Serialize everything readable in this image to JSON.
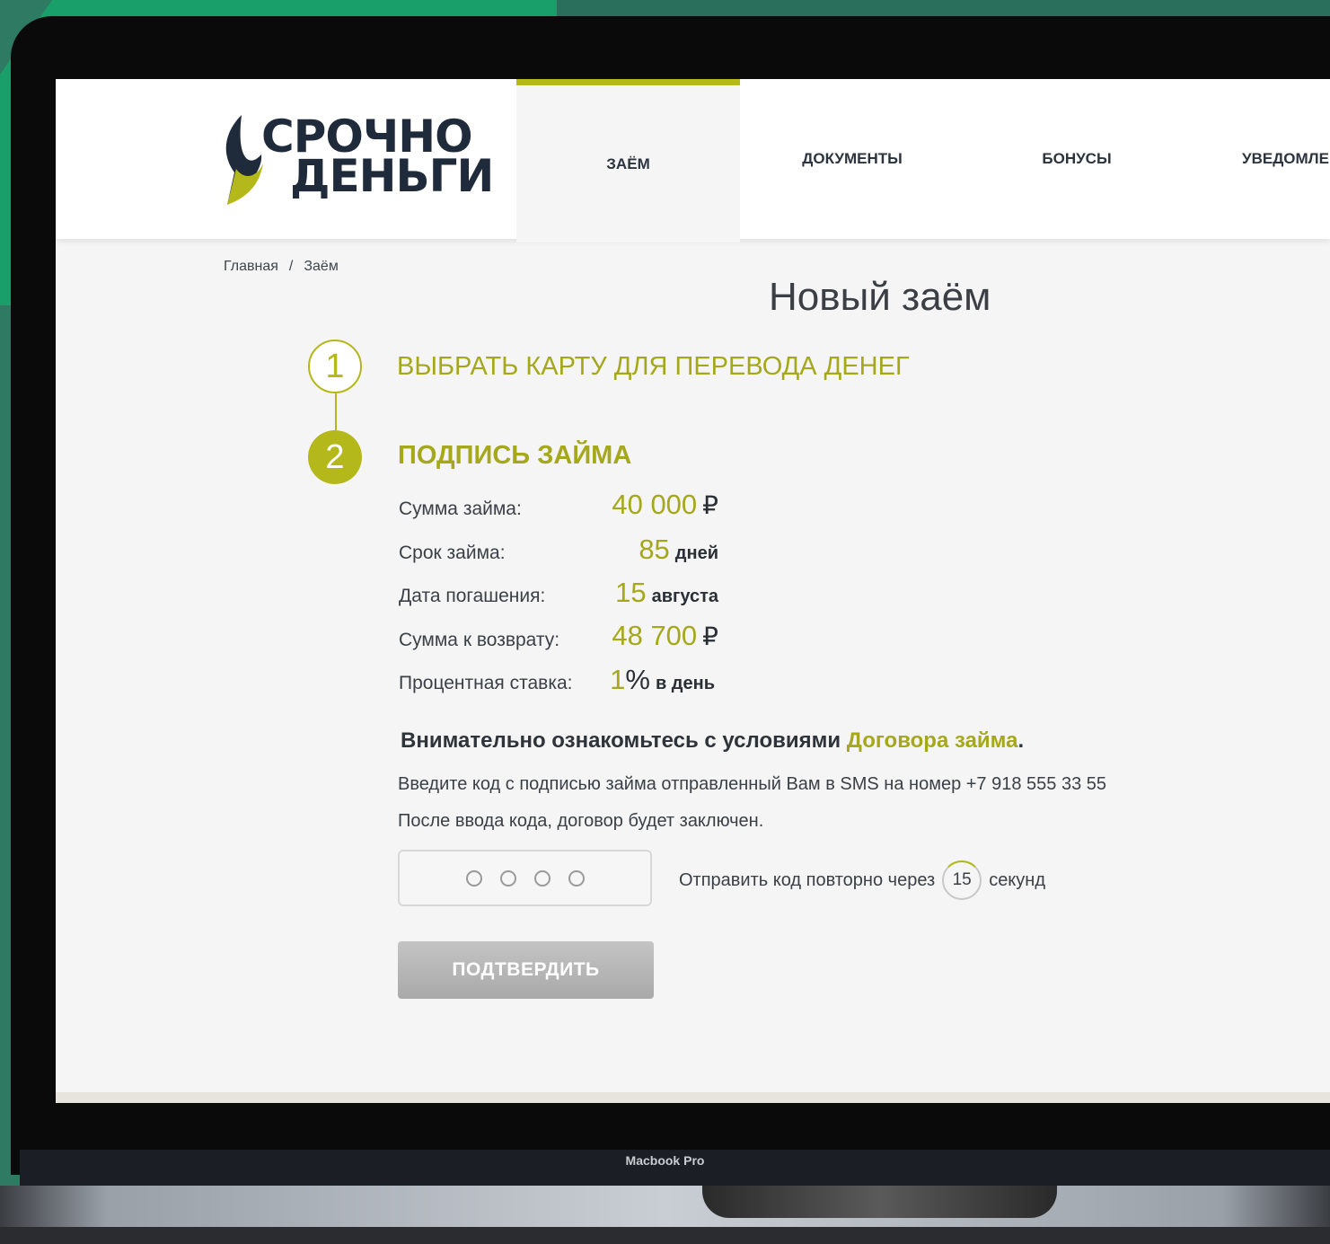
{
  "device": {
    "label": "Macbook Pro"
  },
  "logo": {
    "line1": "СРОЧНО",
    "line2": "ДЕНЬГИ"
  },
  "nav": {
    "items": [
      {
        "label": "ЗАЁМ",
        "active": true
      },
      {
        "label": "ДОКУМЕНТЫ",
        "active": false
      },
      {
        "label": "БОНУСЫ",
        "active": false
      },
      {
        "label": "УВЕДОМЛЕ",
        "active": false
      }
    ]
  },
  "breadcrumb": {
    "home": "Главная",
    "separator": "/",
    "current": "Заём"
  },
  "page": {
    "title": "Новый заём"
  },
  "steps": [
    {
      "number": "1",
      "title": "ВЫБРАТЬ КАРТУ ДЛЯ ПЕРЕВОДА ДЕНЕГ"
    },
    {
      "number": "2",
      "title": "ПОДПИСЬ ЗАЙМА"
    }
  ],
  "loan": {
    "amount": {
      "label": "Сумма займа:",
      "value": "40 000",
      "currency": "₽"
    },
    "term": {
      "label": "Срок займа:",
      "value": "85",
      "unit": "дней"
    },
    "due_date": {
      "label": "Дата погашения:",
      "value": "15",
      "unit": "августа"
    },
    "repayment": {
      "label": "Сумма к возврату:",
      "value": "48 700",
      "currency": "₽"
    },
    "rate": {
      "label": "Процентная ставка:",
      "value": "1",
      "percent": "%",
      "unit": "в день"
    }
  },
  "notice": {
    "text": "Внимательно ознакомьтесь с условиями ",
    "link": "Договора займа",
    "end": ".",
    "sms_line": "Введите код с подписью займа отправленный Вам в SMS на номер +7 918 555 33 55",
    "contract_line": "После ввода кода, договор будет заключен."
  },
  "code": {
    "placeholder_dots": 4
  },
  "resend": {
    "before": "Отправить код повторно через",
    "seconds": "15",
    "after": "секунд"
  },
  "confirm_button": {
    "label": "ПОДТВЕРДИТЬ"
  },
  "colors": {
    "accent": "#b5b81a",
    "text": "#3b4047",
    "brand_dark": "#1f2a3a"
  }
}
